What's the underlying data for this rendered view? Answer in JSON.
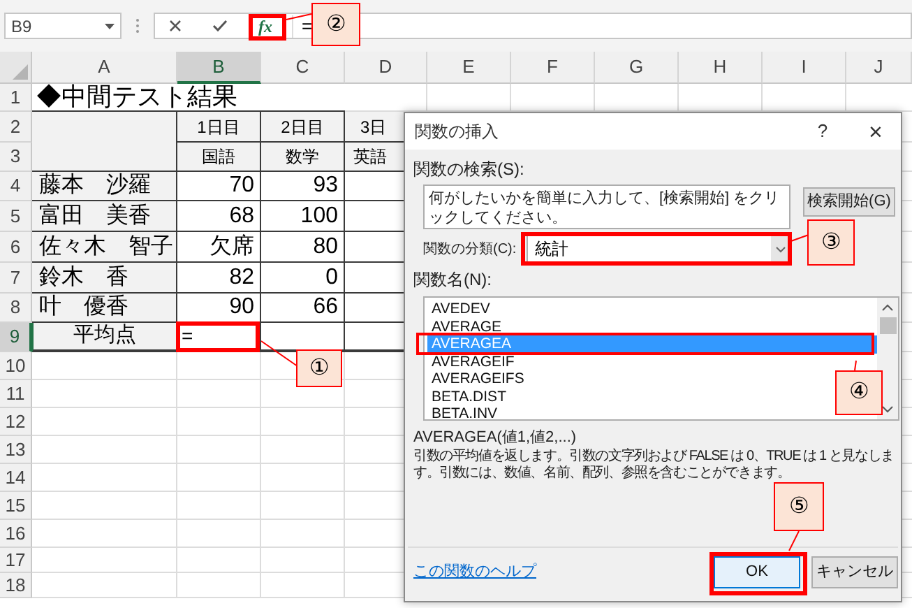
{
  "formula_bar": {
    "name_box": "B9",
    "insert_function_button": "fx",
    "formula": "="
  },
  "columns": [
    {
      "label": "A",
      "selected": false
    },
    {
      "label": "B",
      "selected": true
    },
    {
      "label": "C",
      "selected": false
    },
    {
      "label": "D",
      "selected": false
    },
    {
      "label": "E",
      "selected": false
    },
    {
      "label": "F",
      "selected": false
    },
    {
      "label": "G",
      "selected": false
    },
    {
      "label": "H",
      "selected": false
    },
    {
      "label": "I",
      "selected": false
    },
    {
      "label": "J",
      "selected": false
    }
  ],
  "rows": [
    {
      "label": "1",
      "selected": false
    },
    {
      "label": "2",
      "selected": false
    },
    {
      "label": "3",
      "selected": false
    },
    {
      "label": "4",
      "selected": false
    },
    {
      "label": "5",
      "selected": false
    },
    {
      "label": "6",
      "selected": false
    },
    {
      "label": "7",
      "selected": false
    },
    {
      "label": "8",
      "selected": false
    },
    {
      "label": "9",
      "selected": true
    },
    {
      "label": "10",
      "selected": false
    },
    {
      "label": "11",
      "selected": false
    },
    {
      "label": "12",
      "selected": false
    },
    {
      "label": "13",
      "selected": false
    },
    {
      "label": "14",
      "selected": false
    },
    {
      "label": "15",
      "selected": false
    },
    {
      "label": "16",
      "selected": false
    },
    {
      "label": "17",
      "selected": false
    },
    {
      "label": "18",
      "selected": false
    }
  ],
  "sheet": {
    "title": "◆中間テスト結果",
    "days": [
      "1日目",
      "2日目",
      "3日"
    ],
    "subjects": [
      "国語",
      "数学",
      "英語"
    ],
    "students": [
      {
        "name": "藤本　沙羅",
        "scores": [
          "70",
          "93"
        ]
      },
      {
        "name": "富田　美香",
        "scores": [
          "68",
          "100"
        ]
      },
      {
        "name": "佐々木　智子",
        "scores": [
          "欠席",
          "80"
        ]
      },
      {
        "name": "鈴木　香",
        "scores": [
          "82",
          "0"
        ]
      },
      {
        "name": "叶　優香",
        "scores": [
          "90",
          "66"
        ]
      }
    ],
    "average_label": "平均点",
    "active_cell_value": "="
  },
  "dialog": {
    "title": "関数の挿入",
    "help": "?",
    "close": "×",
    "search_label": "関数の検索(S):",
    "search_value": "何がしたいかを簡単に入力して、[検索開始] をクリックしてください。",
    "search_button": "検索開始(G)",
    "category_label": "関数の分類(C):",
    "category_value": "統計",
    "function_list_label": "関数名(N):",
    "functions": [
      {
        "name": "AVEDEV",
        "selected": false
      },
      {
        "name": "AVERAGE",
        "selected": false
      },
      {
        "name": "AVERAGEA",
        "selected": true
      },
      {
        "name": "AVERAGEIF",
        "selected": false
      },
      {
        "name": "AVERAGEIFS",
        "selected": false
      },
      {
        "name": "BETA.DIST",
        "selected": false
      },
      {
        "name": "BETA.INV",
        "selected": false
      }
    ],
    "syntax": "AVERAGEA(値1,値2,...)",
    "description": "引数の平均値を返します。引数の文字列および FALSE は 0、TRUE は 1 と見なします。引数には、数値、名前、配列、参照を含むことができます。",
    "help_link": "この関数のヘルプ",
    "buttons": [
      {
        "label": "OK",
        "kind": "primary"
      },
      {
        "label": "キャンセル",
        "kind": "secondary"
      }
    ]
  },
  "callouts": [
    {
      "label": "①"
    },
    {
      "label": "②"
    },
    {
      "label": "③"
    },
    {
      "label": "④"
    },
    {
      "label": "⑤"
    }
  ]
}
